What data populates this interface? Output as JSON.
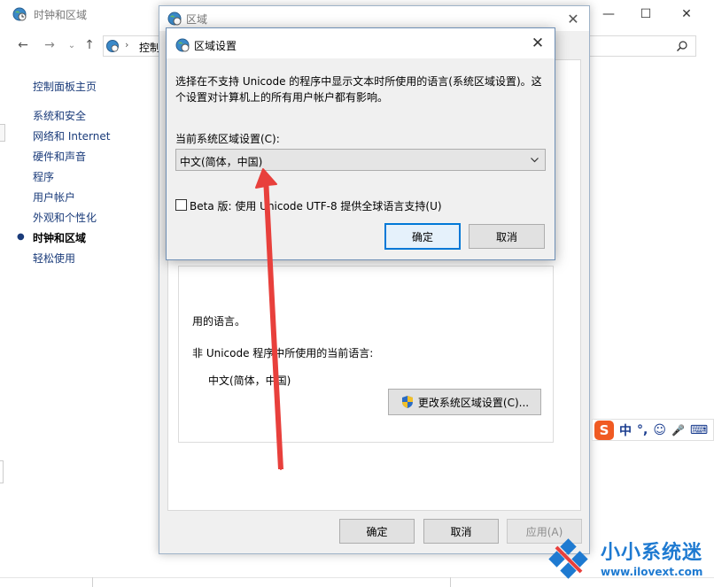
{
  "control_panel": {
    "title": "时钟和区域",
    "address_segment": "控制",
    "sidebar": {
      "home": "控制面板主页",
      "items": [
        {
          "label": "系统和安全",
          "active": false
        },
        {
          "label": "网络和 Internet",
          "active": false
        },
        {
          "label": "硬件和声音",
          "active": false
        },
        {
          "label": "程序",
          "active": false
        },
        {
          "label": "用户帐户",
          "active": false
        },
        {
          "label": "外观和个性化",
          "active": false
        },
        {
          "label": "时钟和区域",
          "active": true
        },
        {
          "label": "轻松使用",
          "active": false
        }
      ]
    },
    "window_controls": {
      "minimize": "—",
      "maximize": "☐",
      "close": "✕"
    }
  },
  "region_dialog": {
    "title": "区域",
    "partial_text": "用的语言。",
    "non_unicode_label": "非 Unicode 程序中所使用的当前语言:",
    "current_language": "中文(简体，中国)",
    "change_locale_button": "更改系统区域设置(C)...",
    "ok_button": "确定",
    "cancel_button": "取消",
    "apply_button": "应用(A)",
    "close": "✕"
  },
  "region_settings_dialog": {
    "title": "区域设置",
    "description_line1": "选择在不支持 Unicode 的程序中显示文本时所使用的语言(系统区域设置)。这",
    "description_line2": "个设置对计算机上的所有用户帐户都有影响。",
    "current_locale_label": "当前系统区域设置(C):",
    "current_locale_value": "中文(简体，中国)",
    "beta_checkbox_label": "Beta 版: 使用 Unicode UTF-8 提供全球语言支持(U)",
    "beta_checked": false,
    "ok_button": "确定",
    "cancel_button": "取消",
    "close": "✕"
  },
  "ime_toolbar": {
    "logo": "S",
    "items": [
      "中",
      "°,",
      "☺",
      "🎤",
      "⌨"
    ]
  },
  "watermark": {
    "title": "小小系统迷",
    "url": "www.ilovext.com"
  },
  "colors": {
    "link": "#1a3b7a",
    "accent": "#0078d7",
    "arrow": "#e8403c",
    "watermark": "#1e7ad1",
    "ime_logo": "#f05a22"
  }
}
